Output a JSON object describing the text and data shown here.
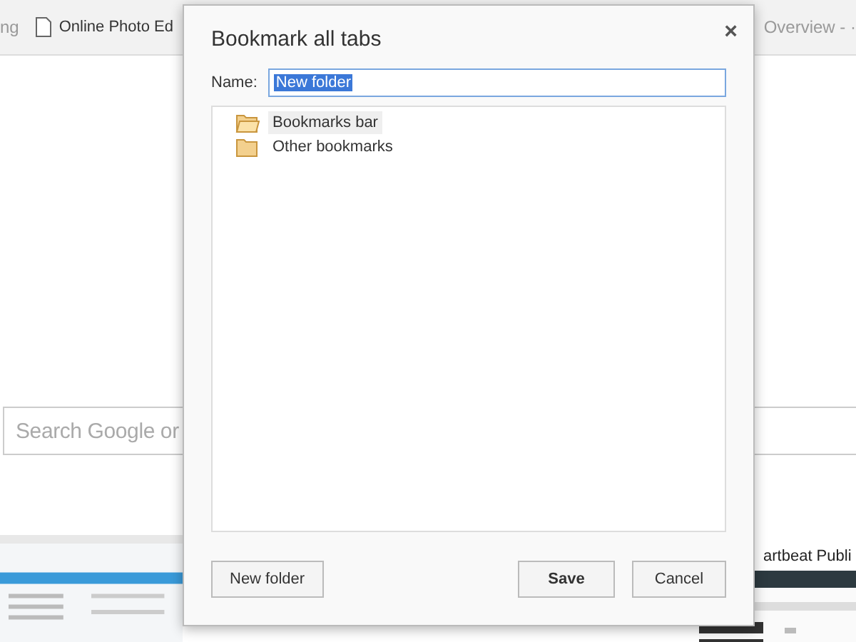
{
  "bookmarks_bar": [
    {
      "label": "ng",
      "kind": "plain"
    },
    {
      "label": "Online Photo Ed",
      "kind": "page"
    },
    {
      "label": "Overview - ·",
      "kind": "plain"
    }
  ],
  "search": {
    "placeholder": "Search Google or"
  },
  "tiles": [
    {
      "kind": "picture"
    },
    {
      "kind": "picture",
      "title": "artbeat Publi"
    }
  ],
  "dialog": {
    "title": "Bookmark all tabs",
    "close": "×",
    "name_label": "Name:",
    "name_value": "New folder",
    "folders": [
      {
        "label": "Bookmarks bar",
        "selected": true,
        "expanded": true
      },
      {
        "label": "Other bookmarks",
        "selected": false,
        "expanded": false
      }
    ],
    "buttons": [
      {
        "label": "New folder",
        "kind": "plain"
      },
      {
        "label": "Save",
        "kind": "default"
      },
      {
        "label": "Cancel",
        "kind": "plain"
      }
    ]
  }
}
